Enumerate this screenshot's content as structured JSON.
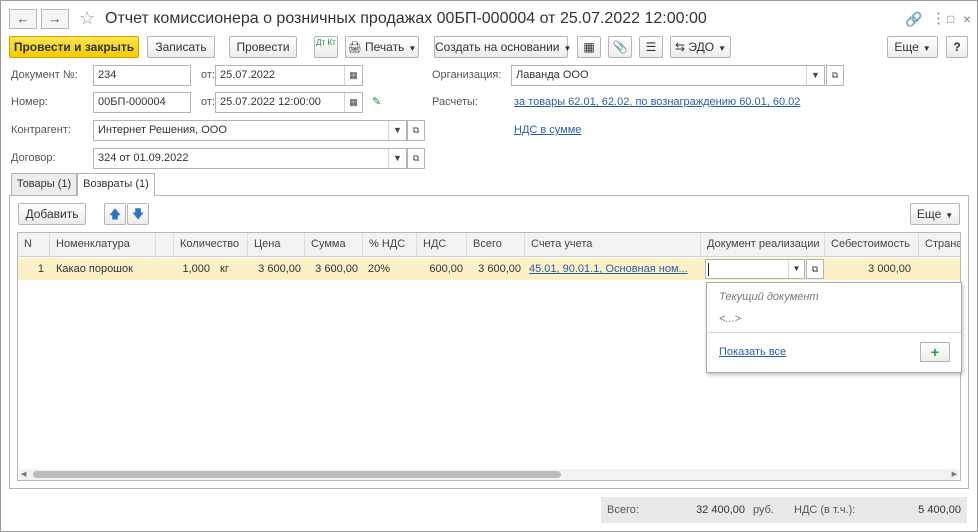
{
  "header": {
    "title": "Отчет комиссионера о розничных продажах 00БП-000004 от 25.07.2022 12:00:00",
    "back_icon": "arrow-left-icon",
    "forward_icon": "arrow-right-icon",
    "favorite_icon": "star-icon",
    "link_icon": "link-icon",
    "more_icon": "vertical-dots-icon",
    "maximize_icon": "maximize-icon",
    "close_icon": "close-icon"
  },
  "toolbar": {
    "post_close": "Провести и закрыть",
    "save": "Записать",
    "post": "Провести",
    "dt_kt": "Дт Кт",
    "print": "Печать",
    "create_based": "Создать на основании",
    "edo": "ЭДО",
    "more": "Еще",
    "help": "?"
  },
  "form": {
    "doc_no_label": "Документ №:",
    "doc_no_value": "234",
    "doc_date_label": "от:",
    "doc_date_value": "25.07.2022",
    "number_label": "Номер:",
    "number_value": "00БП-000004",
    "number_date_label": "от:",
    "number_date_value": "25.07.2022 12:00:00",
    "org_label": "Организация:",
    "org_value": "Лаванда ООО",
    "settlements_label": "Расчеты:",
    "settlements_link": "за товары 62.01, 62.02, по вознаграждению 60.01, 60.02",
    "vat_link": "НДС в сумме",
    "contractor_label": "Контрагент:",
    "contractor_value": "Интернет Решения, ООО",
    "contract_label": "Договор:",
    "contract_value": "324 от 01.09.2022"
  },
  "tabs": [
    {
      "label": "Товары (1)"
    },
    {
      "label": "Возвраты (1)"
    }
  ],
  "grid_toolbar": {
    "add": "Добавить",
    "more": "Еще"
  },
  "grid": {
    "columns": [
      "N",
      "Номенклатура",
      "Количество",
      "Цена",
      "Сумма",
      "% НДС",
      "НДС",
      "Всего",
      "Счета учета",
      "Документ реализации",
      "Себестоимость",
      "Страна"
    ],
    "rows": [
      {
        "n": "1",
        "item": "Какао порошок",
        "qty": "1,000",
        "unit": "кг",
        "price": "3 600,00",
        "sum": "3 600,00",
        "vat_rate": "20%",
        "vat": "600,00",
        "total": "3 600,00",
        "accounts": "45.01, 90.01.1, Основная ном...",
        "sale_doc": "",
        "cost": "3 000,00",
        "country": ""
      }
    ]
  },
  "dropdown": {
    "items": [
      "Текущий документ",
      "<...>"
    ],
    "show_all": "Показать все",
    "add": "+"
  },
  "footer": {
    "total_label": "Всего:",
    "total_value": "32 400,00",
    "currency": "руб.",
    "vat_label": "НДС (в т.ч.):",
    "vat_value": "5 400,00"
  }
}
